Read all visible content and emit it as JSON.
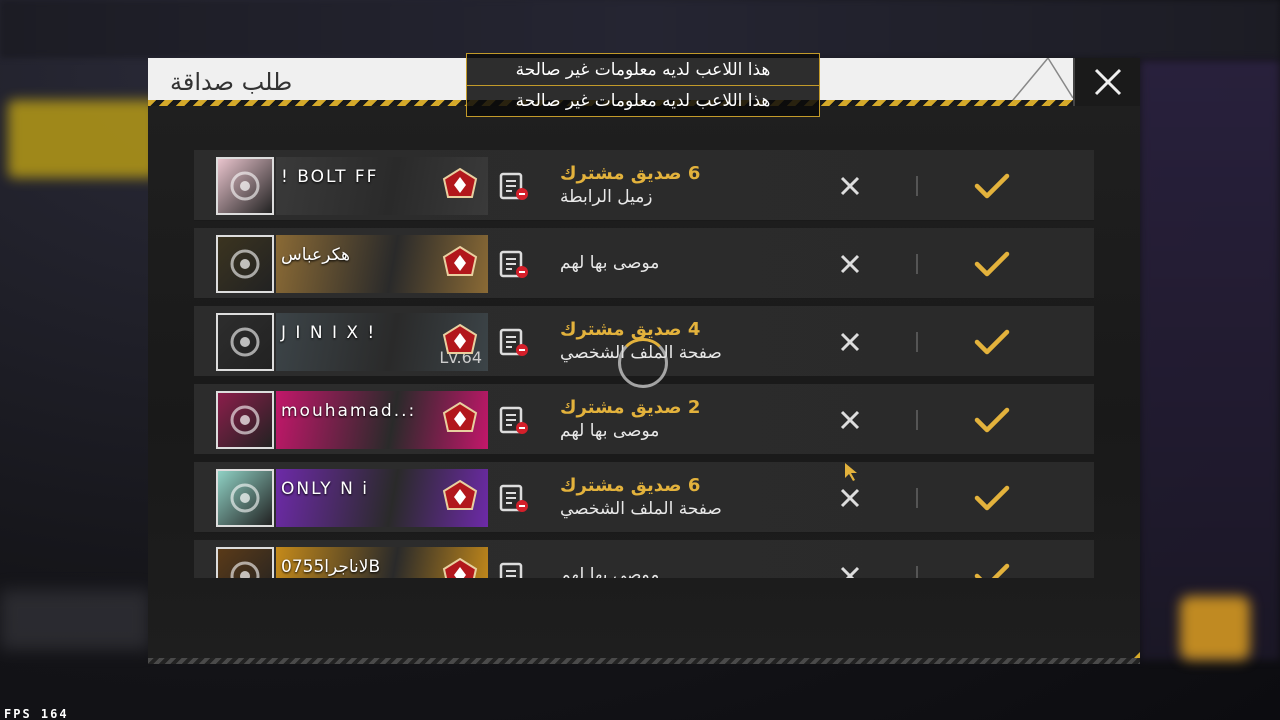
{
  "dialog": {
    "title": "طلب صداقة",
    "close_icon": "close-icon"
  },
  "toasts": [
    "هذا اللاعب لديه معلومات غير صالحة",
    "هذا اللاعب لديه معلومات غير صالحة"
  ],
  "requests": [
    {
      "name": "!  BOLT  FF",
      "level": "",
      "mutual": "6 صديق مشترك",
      "source": "زميل الرابطة",
      "avatar_color": "#e9c4cd",
      "banner_color": "#3a3a3a"
    },
    {
      "name": "هكرعباس",
      "level": "",
      "mutual": "",
      "source": "موصى بها لهم",
      "avatar_color": "#3b3420",
      "banner_color": "#8a6a35"
    },
    {
      "name": "J I N I X !",
      "level": "Lv.64",
      "mutual": "4 صديق مشترك",
      "source": "صفحة الملف الشخصي",
      "avatar_color": "#2d2d2d",
      "banner_color": "#3c4448"
    },
    {
      "name": "mouhamad..:",
      "level": "",
      "mutual": "2 صديق مشترك",
      "source": "موصى بها لهم",
      "avatar_color": "#8b1e4b",
      "banner_color": "#c2176a"
    },
    {
      "name": "ONLY    N i",
      "level": "",
      "mutual": "6 صديق مشترك",
      "source": "صفحة الملف الشخصي",
      "avatar_color": "#8fd1c4",
      "banner_color": "#6d2aa8"
    },
    {
      "name": "لاناجرا0755B",
      "level": "",
      "mutual": "",
      "source": "موصى بها لهم",
      "avatar_color": "#5a3a18",
      "banner_color": "#c58a1a"
    }
  ],
  "status": {
    "fps": "FPS  164"
  },
  "colors": {
    "accent": "#e3b23c",
    "header_bg": "#f0f0f0",
    "row_bg": "#2c2c2c"
  }
}
